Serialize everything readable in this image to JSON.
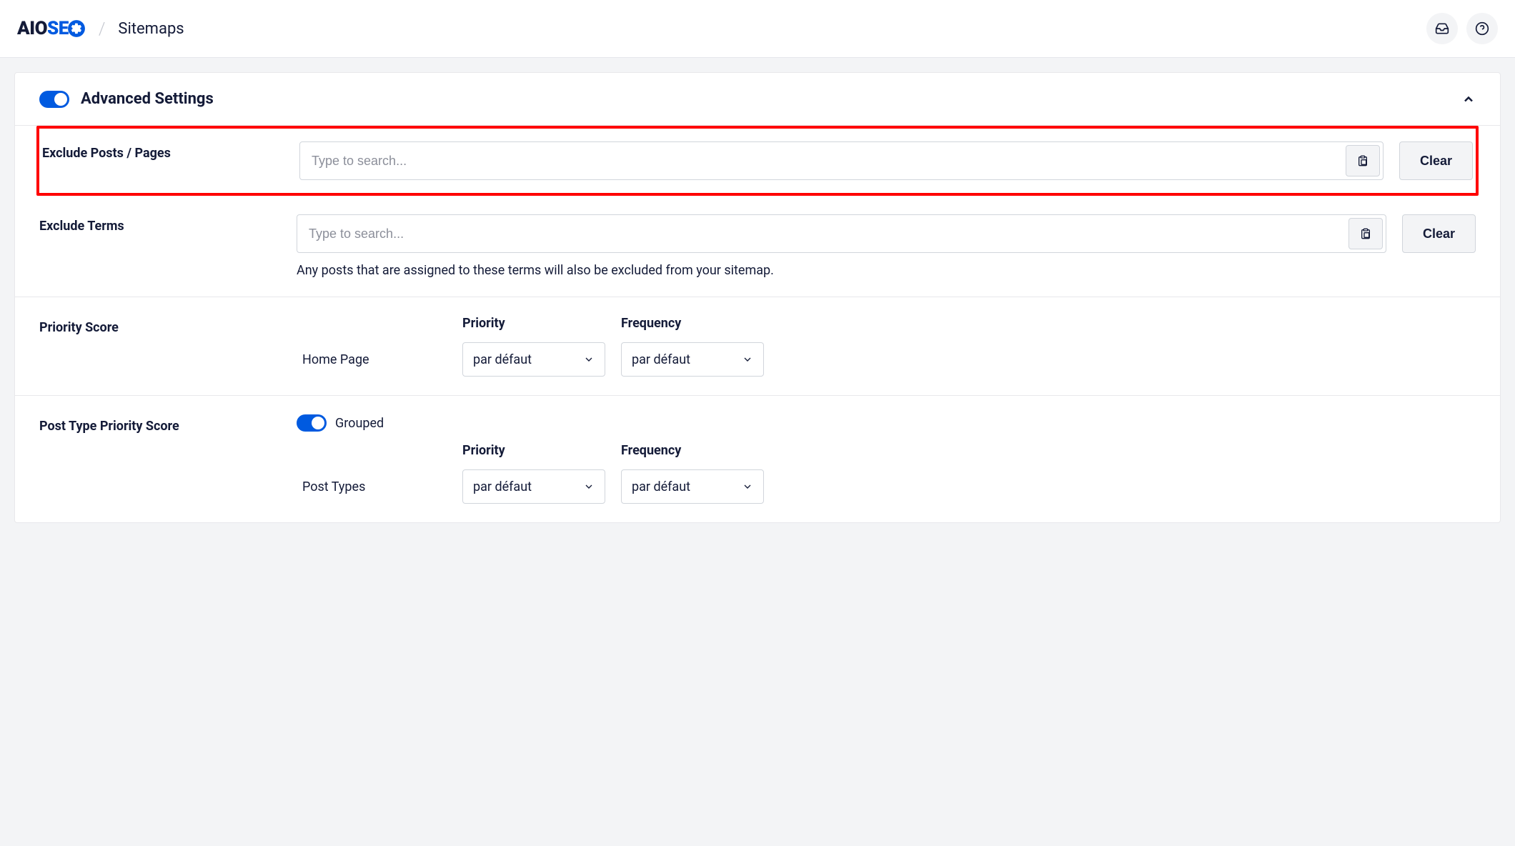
{
  "header": {
    "logo_aio": "AIO",
    "logo_se": "SE",
    "breadcrumb": "Sitemaps"
  },
  "card": {
    "title": "Advanced Settings"
  },
  "excludePosts": {
    "label": "Exclude Posts / Pages",
    "placeholder": "Type to search...",
    "clearLabel": "Clear"
  },
  "excludeTerms": {
    "label": "Exclude Terms",
    "placeholder": "Type to search...",
    "clearLabel": "Clear",
    "helpText": "Any posts that are assigned to these terms will also be excluded from your sitemap."
  },
  "priorityScore": {
    "label": "Priority Score",
    "priorityHeader": "Priority",
    "frequencyHeader": "Frequency",
    "homePage": {
      "label": "Home Page",
      "priority": "par défaut",
      "frequency": "par défaut"
    }
  },
  "postTypePriority": {
    "label": "Post Type Priority Score",
    "groupedLabel": "Grouped",
    "priorityHeader": "Priority",
    "frequencyHeader": "Frequency",
    "postTypes": {
      "label": "Post Types",
      "priority": "par défaut",
      "frequency": "par défaut"
    }
  }
}
